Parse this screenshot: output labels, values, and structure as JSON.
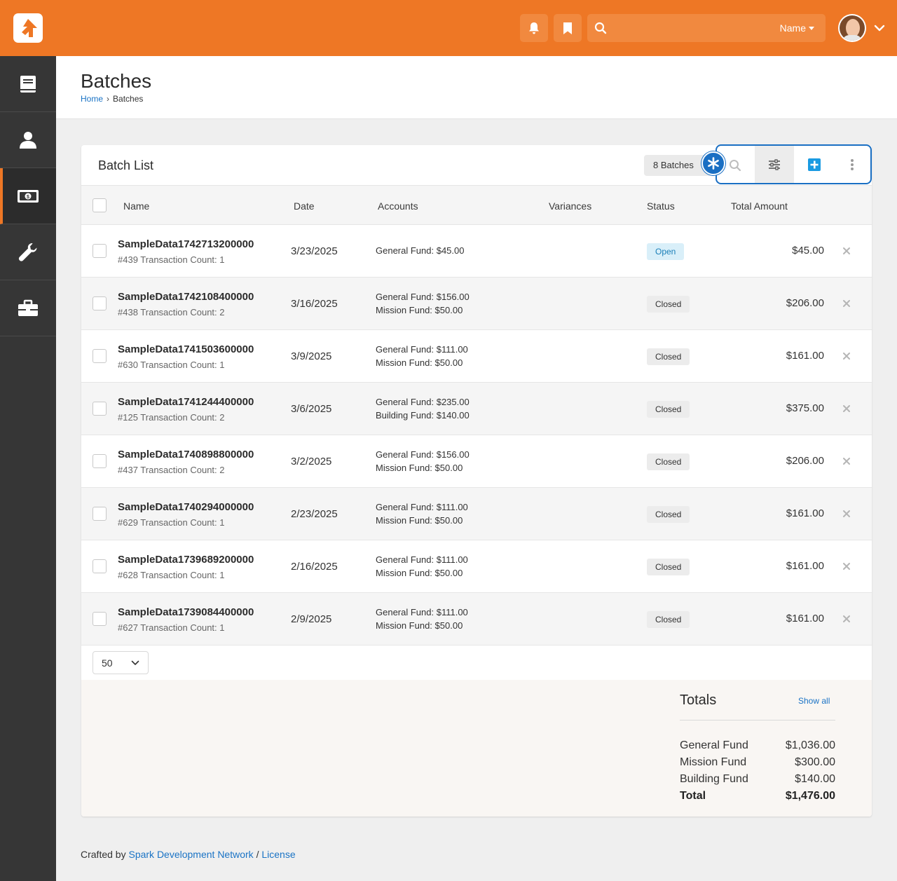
{
  "header": {
    "search_user_label": "Name"
  },
  "page": {
    "title": "Batches",
    "breadcrumb": {
      "home": "Home",
      "current": "Batches"
    }
  },
  "card": {
    "title": "Batch List",
    "count_badge": "8 Batches",
    "columns": {
      "name": "Name",
      "date": "Date",
      "accounts": "Accounts",
      "variances": "Variances",
      "status": "Status",
      "total": "Total Amount"
    }
  },
  "rows": [
    {
      "name": "SampleData1742713200000",
      "sub": "#439 Transaction Count: 1",
      "date": "3/23/2025",
      "acc1": "General Fund: $45.00",
      "acc2": "",
      "status": "Open",
      "amount": "$45.00"
    },
    {
      "name": "SampleData1742108400000",
      "sub": "#438 Transaction Count: 2",
      "date": "3/16/2025",
      "acc1": "General Fund: $156.00",
      "acc2": "Mission Fund: $50.00",
      "status": "Closed",
      "amount": "$206.00"
    },
    {
      "name": "SampleData1741503600000",
      "sub": "#630 Transaction Count: 1",
      "date": "3/9/2025",
      "acc1": "General Fund: $111.00",
      "acc2": "Mission Fund: $50.00",
      "status": "Closed",
      "amount": "$161.00"
    },
    {
      "name": "SampleData1741244400000",
      "sub": "#125 Transaction Count: 2",
      "date": "3/6/2025",
      "acc1": "General Fund: $235.00",
      "acc2": "Building Fund: $140.00",
      "status": "Closed",
      "amount": "$375.00"
    },
    {
      "name": "SampleData1740898800000",
      "sub": "#437 Transaction Count: 2",
      "date": "3/2/2025",
      "acc1": "General Fund: $156.00",
      "acc2": "Mission Fund: $50.00",
      "status": "Closed",
      "amount": "$206.00"
    },
    {
      "name": "SampleData1740294000000",
      "sub": "#629 Transaction Count: 1",
      "date": "2/23/2025",
      "acc1": "General Fund: $111.00",
      "acc2": "Mission Fund: $50.00",
      "status": "Closed",
      "amount": "$161.00"
    },
    {
      "name": "SampleData1739689200000",
      "sub": "#628 Transaction Count: 1",
      "date": "2/16/2025",
      "acc1": "General Fund: $111.00",
      "acc2": "Mission Fund: $50.00",
      "status": "Closed",
      "amount": "$161.00"
    },
    {
      "name": "SampleData1739084400000",
      "sub": "#627 Transaction Count: 1",
      "date": "2/9/2025",
      "acc1": "General Fund: $111.00",
      "acc2": "Mission Fund: $50.00",
      "status": "Closed",
      "amount": "$161.00"
    }
  ],
  "pager": {
    "page_size": "50"
  },
  "totals": {
    "title": "Totals",
    "show_all": "Show all",
    "items": [
      {
        "label": "General Fund",
        "value": "$1,036.00"
      },
      {
        "label": "Mission Fund",
        "value": "$300.00"
      },
      {
        "label": "Building Fund",
        "value": "$140.00"
      }
    ],
    "total_label": "Total",
    "total_value": "$1,476.00"
  },
  "footer": {
    "prefix": "Crafted by",
    "link1": "Spark Development Network",
    "sep": "/",
    "link2": "License"
  },
  "colors": {
    "brand": "#ee7725",
    "accent": "#1a6fc3",
    "sidebar": "#363636"
  },
  "icons": [
    "rock-logo-icon",
    "bell-icon",
    "bookmark-icon",
    "search-icon",
    "chevron-down-icon",
    "book-icon",
    "person-icon",
    "money-icon",
    "wrench-icon",
    "briefcase-icon",
    "asterisk-icon",
    "filter-icon",
    "plus-square-icon",
    "more-vertical-icon",
    "close-icon"
  ]
}
